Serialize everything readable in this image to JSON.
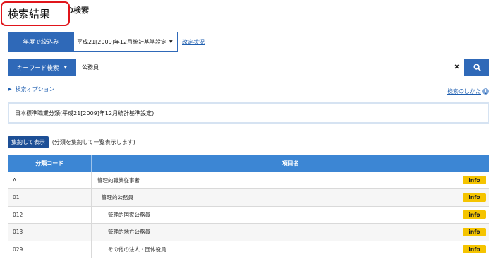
{
  "title_overlay": "検索結果",
  "page_title": "職の検索",
  "narrow": {
    "label": "年度で絞込み",
    "selected": "平成21[2009]年12月統計基準設定",
    "revision_link": "改定状況"
  },
  "keyword": {
    "label": "キーワード検索",
    "value": "公務員"
  },
  "options": {
    "search_option": "検索オプション",
    "howto": "検索のしかた"
  },
  "classification": "日本標準職業分類(平成21[2009]年12月統計基準設定)",
  "aggregate": {
    "button": "集約して表示",
    "note": "(分類を集約して一覧表示します)"
  },
  "table": {
    "headers": [
      "分類コード",
      "項目名"
    ],
    "info_label": "info",
    "rows": [
      {
        "code": "A",
        "name": "管理的職業従事者",
        "level": 0
      },
      {
        "code": "01",
        "name": "管理的公務員",
        "level": 1
      },
      {
        "code": "012",
        "name": "管理的国家公務員",
        "level": 2
      },
      {
        "code": "013",
        "name": "管理的地方公務員",
        "level": 2
      },
      {
        "code": "029",
        "name": "その他の法人・団体役員",
        "level": 2
      }
    ]
  },
  "colors": {
    "primary": "#2f69b8",
    "header": "#3c86d4",
    "info": "#f5c400",
    "overlay_border": "#e0151b"
  }
}
